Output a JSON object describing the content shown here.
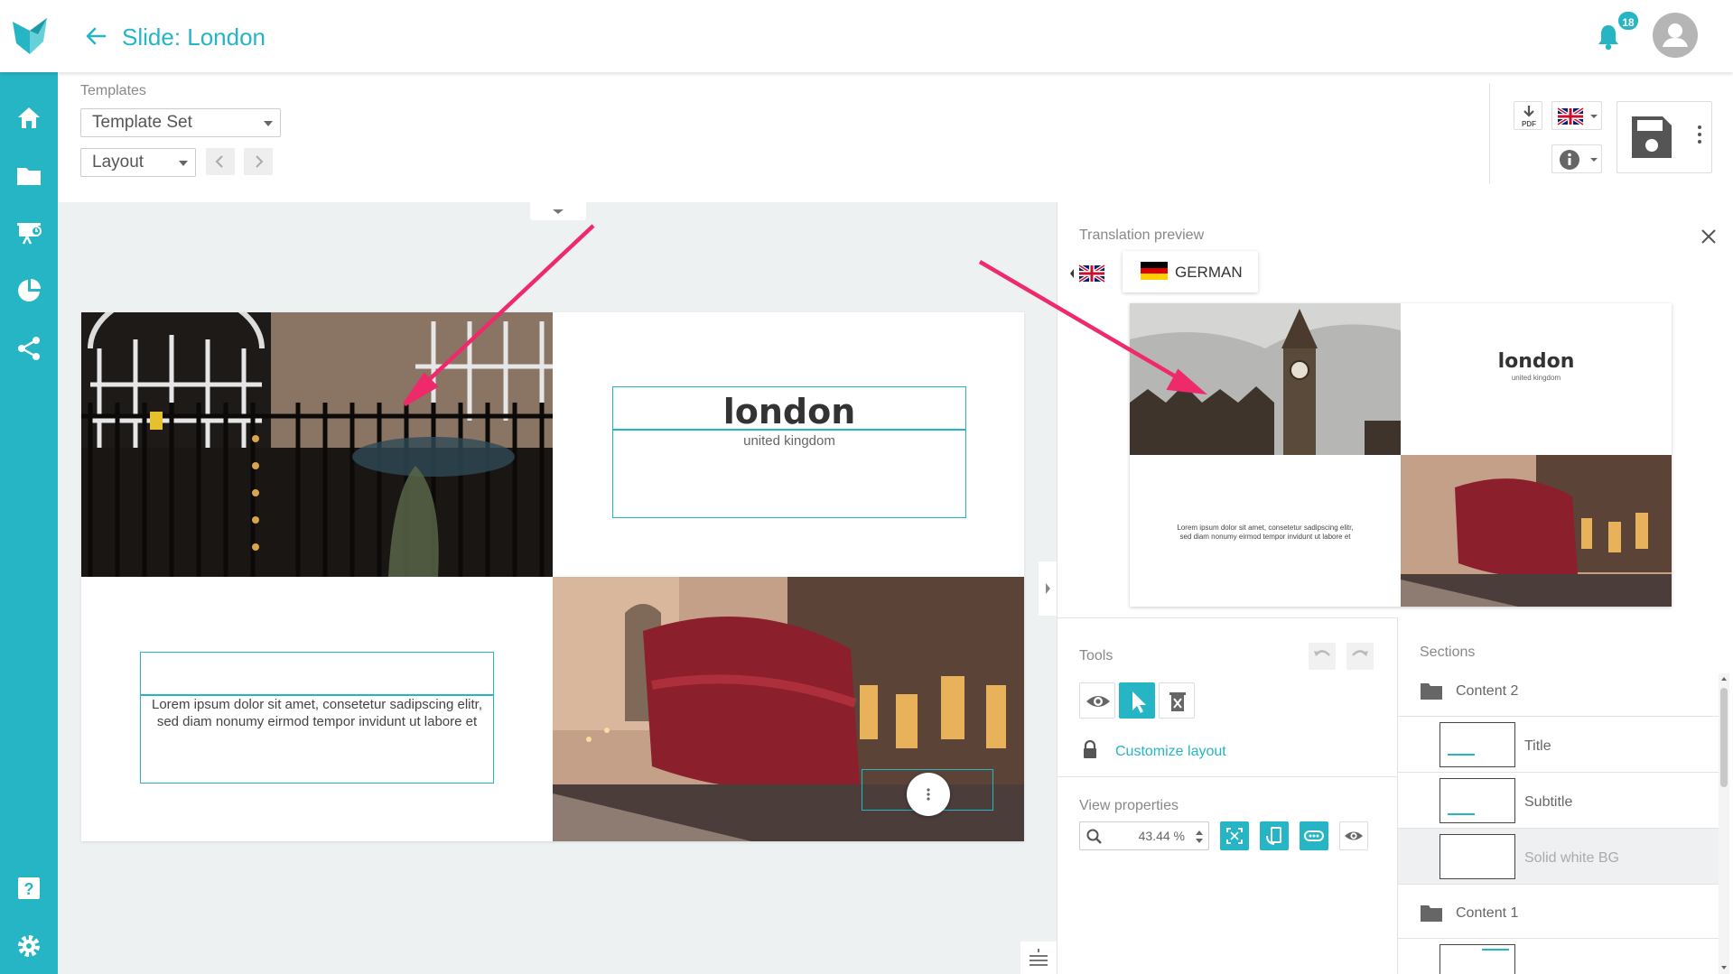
{
  "header": {
    "title": "Slide: London",
    "notification_count": "18"
  },
  "templates": {
    "label": "Templates",
    "template_set": "Template Set",
    "layout": "Layout"
  },
  "slide": {
    "title": "london",
    "subtitle": "united kingdom",
    "body_line1": "Lorem ipsum dolor sit amet, consetetur sadipscing elitr,",
    "body_line2": "sed diam nonumy eirmod tempor invidunt ut labore et"
  },
  "translation_preview": {
    "label": "Translation preview",
    "language": "GERMAN",
    "title": "london",
    "subtitle": "united kingdom",
    "body_line1": "Lorem ipsum dolor sit amet, consetetur sadipscing elitr,",
    "body_line2": "sed diam nonumy eirmod tempor invidunt ut labore et"
  },
  "tools": {
    "label": "Tools",
    "customize_layout": "Customize layout"
  },
  "view_properties": {
    "label": "View properties",
    "zoom": "43.44 %"
  },
  "sections": {
    "label": "Sections",
    "items": [
      {
        "label": "Content 2",
        "type": "folder"
      },
      {
        "label": "Title",
        "type": "layer"
      },
      {
        "label": "Subtitle",
        "type": "layer"
      },
      {
        "label": "Solid white BG",
        "type": "layer"
      },
      {
        "label": "Content 1",
        "type": "folder"
      }
    ]
  },
  "colors": {
    "accent": "#26b5c5",
    "arrow": "#ee2a6b"
  }
}
